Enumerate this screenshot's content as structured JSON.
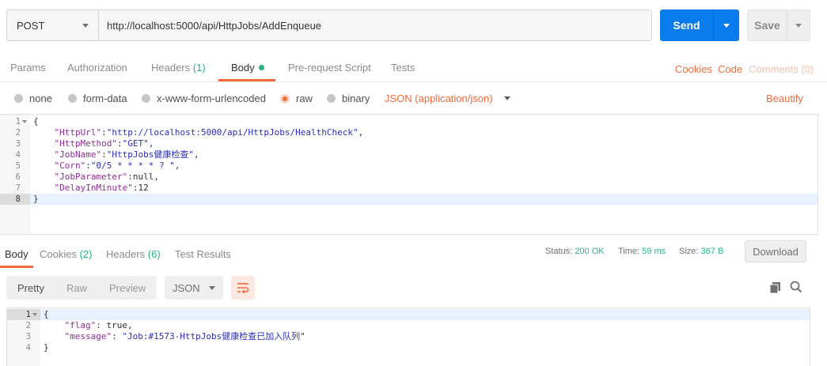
{
  "request": {
    "method": "POST",
    "url": "http://localhost:5000/api/HttpJobs/AddEnqueue",
    "send_label": "Send",
    "save_label": "Save"
  },
  "request_tabs": {
    "params": "Params",
    "authorization": "Authorization",
    "headers": "Headers",
    "headers_count": "(1)",
    "body": "Body",
    "prerequest": "Pre-request Script",
    "tests": "Tests",
    "cookies": "Cookies",
    "code": "Code",
    "comments": "Comments (0)"
  },
  "body_types": {
    "none": "none",
    "form_data": "form-data",
    "urlencoded": "x-www-form-urlencoded",
    "raw": "raw",
    "binary": "binary",
    "content_type": "JSON (application/json)",
    "beautify": "Beautify"
  },
  "request_body": {
    "line_numbers": [
      "1",
      "2",
      "3",
      "4",
      "5",
      "6",
      "7",
      "8"
    ],
    "open_brace": "{",
    "close_brace": "}",
    "k1": "\"HttpUrl\"",
    "v1": "\"http://localhost:5000/api/HttpJobs/HealthCheck\"",
    "k2": "\"HttpMethod\"",
    "v2": "\"GET\"",
    "k3": "\"JobName\"",
    "v3": "\"HttpJobs健康检查\"",
    "k4": "\"Corn\"",
    "v4": "\"0/5 * * * * ? \"",
    "k5": "\"JobParameter\"",
    "v5": "null",
    "k6": "\"DelayInMinute\"",
    "v6": "12"
  },
  "response_tabs": {
    "body": "Body",
    "cookies": "Cookies",
    "cookies_count": "(2)",
    "headers": "Headers",
    "headers_count": "(6)",
    "test_results": "Test Results",
    "status_label": "Status:",
    "status_value": "200 OK",
    "time_label": "Time:",
    "time_value": "59 ms",
    "size_label": "Size:",
    "size_value": "367 B",
    "download": "Download"
  },
  "response_toolbar": {
    "pretty": "Pretty",
    "raw": "Raw",
    "preview": "Preview",
    "format": "JSON"
  },
  "response_body": {
    "line_numbers": [
      "1",
      "2",
      "3",
      "4"
    ],
    "open_brace": "{",
    "close_brace": "}",
    "k1": "\"flag\"",
    "v1": "true",
    "k2": "\"message\"",
    "v2": "\"Job:#1573-HttpJobs健康检查已加入队列\""
  },
  "colors": {
    "accent": "#f26b3a",
    "primary": "#097bed",
    "success": "#26b47f"
  }
}
